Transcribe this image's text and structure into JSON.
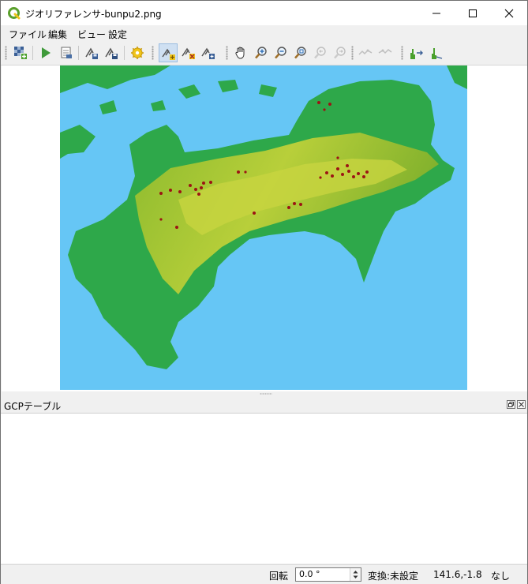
{
  "window": {
    "title": "ジオリファレンサ-bunpu2.png",
    "controls": [
      "minimize",
      "maximize",
      "close"
    ]
  },
  "menubar": {
    "items": [
      {
        "label": "ファイル"
      },
      {
        "label": "編集"
      },
      {
        "label": "ビュー"
      },
      {
        "label": "設定"
      }
    ]
  },
  "toolbar": {
    "buttons": [
      {
        "icon": "open-raster-icon"
      },
      {
        "icon": "start-georeferencing-icon"
      },
      {
        "icon": "generate-gdal-script-icon"
      },
      {
        "icon": "load-gcp-points-icon"
      },
      {
        "icon": "save-gcp-points-icon"
      },
      {
        "icon": "transformation-settings-icon"
      },
      {
        "icon": "add-point-icon"
      },
      {
        "icon": "delete-point-icon"
      },
      {
        "icon": "move-gcp-point-icon"
      },
      {
        "icon": "pan-icon"
      },
      {
        "icon": "zoom-in-icon"
      },
      {
        "icon": "zoom-out-icon"
      },
      {
        "icon": "zoom-to-layer-icon"
      },
      {
        "icon": "zoom-last-icon"
      },
      {
        "icon": "zoom-next-icon"
      },
      {
        "icon": "link-georeferencer-icon"
      },
      {
        "icon": "link-qgis-icon"
      },
      {
        "icon": "full-histogram-stretch-icon"
      },
      {
        "icon": "local-histogram-stretch-icon"
      }
    ]
  },
  "gcp_panel": {
    "title": "GCPテーブル"
  },
  "statusbar": {
    "rotation_label": "回転",
    "rotation_value": "0.0 °",
    "transform_label": "変換:未設定",
    "coordinates": "141.6,-1.8",
    "crs": "なし"
  },
  "colors": {
    "sea": "#66c6f5",
    "lowland": "#2ea84a",
    "highland": "#a8c832",
    "distribution_point": "#9c1414"
  }
}
